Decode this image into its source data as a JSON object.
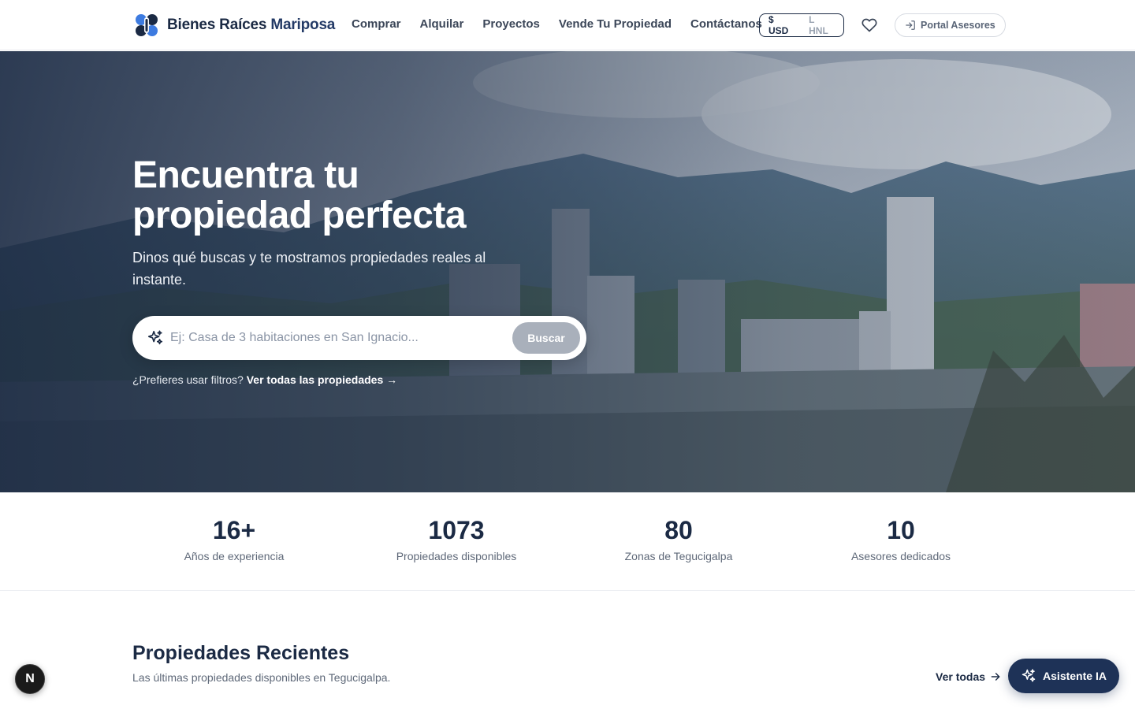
{
  "header": {
    "brand_first": "Bienes Raíces",
    "brand_second": "Mariposa",
    "nav": [
      "Comprar",
      "Alquilar",
      "Proyectos",
      "Vende Tu Propiedad",
      "Contáctanos"
    ],
    "currency_active": "$ USD",
    "currency_inactive": "L HNL",
    "portal_label": "Portal Asesores"
  },
  "hero": {
    "title_line1": "Encuentra tu",
    "title_line2": "propiedad perfecta",
    "subtitle": "Dinos qué buscas y te mostramos propiedades reales al instante.",
    "search_placeholder": "Ej: Casa de 3 habitaciones en San Ignacio...",
    "search_button": "Buscar",
    "filters_prompt": "¿Prefieres usar filtros?",
    "filters_link": "Ver todas las propiedades →"
  },
  "stats": [
    {
      "value": "16+",
      "label": "Años de experiencia"
    },
    {
      "value": "1073",
      "label": "Propiedades disponibles"
    },
    {
      "value": "80",
      "label": "Zonas de Tegucigalpa"
    },
    {
      "value": "10",
      "label": "Asesores dedicados"
    }
  ],
  "recent": {
    "title": "Propiedades Recientes",
    "subtitle": "Las últimas propiedades disponibles en Tegucigalpa.",
    "see_all": "Ver todas"
  },
  "dev_badge": "N",
  "assistant_label": "Asistente IA",
  "colors": {
    "primary": "#1e3257",
    "logo_blue": "#3d7be0",
    "logo_dark": "#1b2a44",
    "search_button": "#a9b0bb"
  }
}
